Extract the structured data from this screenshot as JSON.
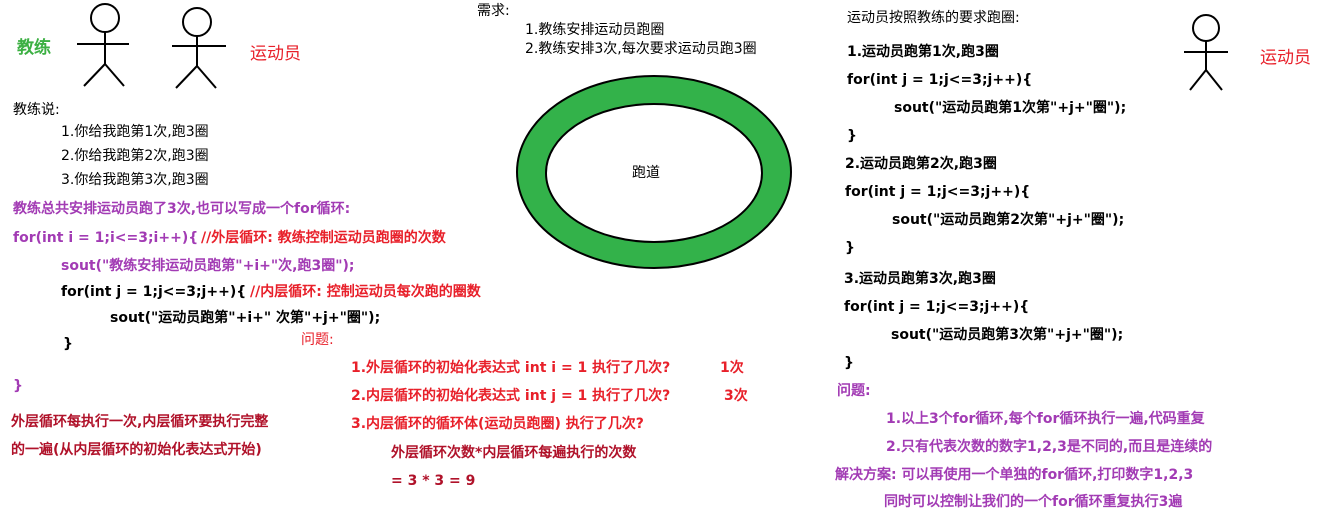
{
  "colors": {
    "green": "#3cb043",
    "red": "#e8202a",
    "purple": "#a23bb4",
    "dark_red": "#b0122a",
    "track": "#33b24a"
  },
  "figures": {
    "coach_label": "教练",
    "athlete_label": "运动员",
    "athlete_label_right": "运动员"
  },
  "coach_says": {
    "title": "教练说:",
    "items": [
      "1.你给我跑第1次,跑3圈",
      "2.你给我跑第2次,跑3圈",
      "3.你给我跑第3次,跑3圈"
    ]
  },
  "summary": "教练总共安排运动员跑了3次,也可以写成一个for循环:",
  "nested_code": {
    "outer_line": "for(int i = 1;i<=3;i++){",
    "outer_comment": "//外层循环: 教练控制运动员跑圈的次数",
    "sout_outer": "sout(\"教练安排运动员跑第\"+i+\"次,跑3圈\");",
    "inner_line": "for(int j = 1;j<=3;j++){",
    "inner_comment": "//内层循环: 控制运动员每次跑的圈数",
    "sout_inner": "sout(\"运动员跑第\"+i+\" 次第\"+j+\"圈\");",
    "inner_close": "}",
    "outer_close": "}"
  },
  "explanation": [
    "外层循环每执行一次,内层循环要执行完整",
    "的一遍(从内层循环的初始化表达式开始)"
  ],
  "questions": {
    "title": "问题:",
    "items": [
      {
        "text": "1.外层循环的初始化表达式 int i = 1 执行了几次?",
        "answer": "1次"
      },
      {
        "text": "2.内层循环的初始化表达式 int j = 1 执行了几次?",
        "answer": "3次"
      },
      {
        "text": "3.内层循环的循环体(运动员跑圈) 执行了几次?",
        "answer": ""
      }
    ],
    "formula": "外层循环次数*内层循环每遍执行的次数",
    "result": "= 3 * 3 = 9"
  },
  "requirements": {
    "title": "需求:",
    "items": [
      "1.教练安排运动员跑圈",
      "2.教练安排3次,每次要求运动员跑3圈"
    ]
  },
  "track_label": "跑道",
  "athlete_section": {
    "title": "运动员按照教练的要求跑圈:",
    "blocks": [
      {
        "heading": "1.运动员跑第1次,跑3圈",
        "for_line": "for(int j = 1;j<=3;j++){",
        "sout": "sout(\"运动员跑第1次第\"+j+\"圈\");",
        "close": "}"
      },
      {
        "heading": "2.运动员跑第2次,跑3圈",
        "for_line": "for(int j = 1;j<=3;j++){",
        "sout": "sout(\"运动员跑第2次第\"+j+\"圈\");",
        "close": "}"
      },
      {
        "heading": "3.运动员跑第3次,跑3圈",
        "for_line": "for(int j = 1;j<=3;j++){",
        "sout": "sout(\"运动员跑第3次第\"+j+\"圈\");",
        "close": "}"
      }
    ]
  },
  "problems": {
    "title": "问题:",
    "items": [
      "1.以上3个for循环,每个for循环执行一遍,代码重复",
      "2.只有代表次数的数字1,2,3是不同的,而且是连续的"
    ]
  },
  "solution": [
    "解决方案: 可以再使用一个单独的for循环,打印数字1,2,3",
    "同时可以控制让我们的一个for循环重复执行3遍"
  ]
}
